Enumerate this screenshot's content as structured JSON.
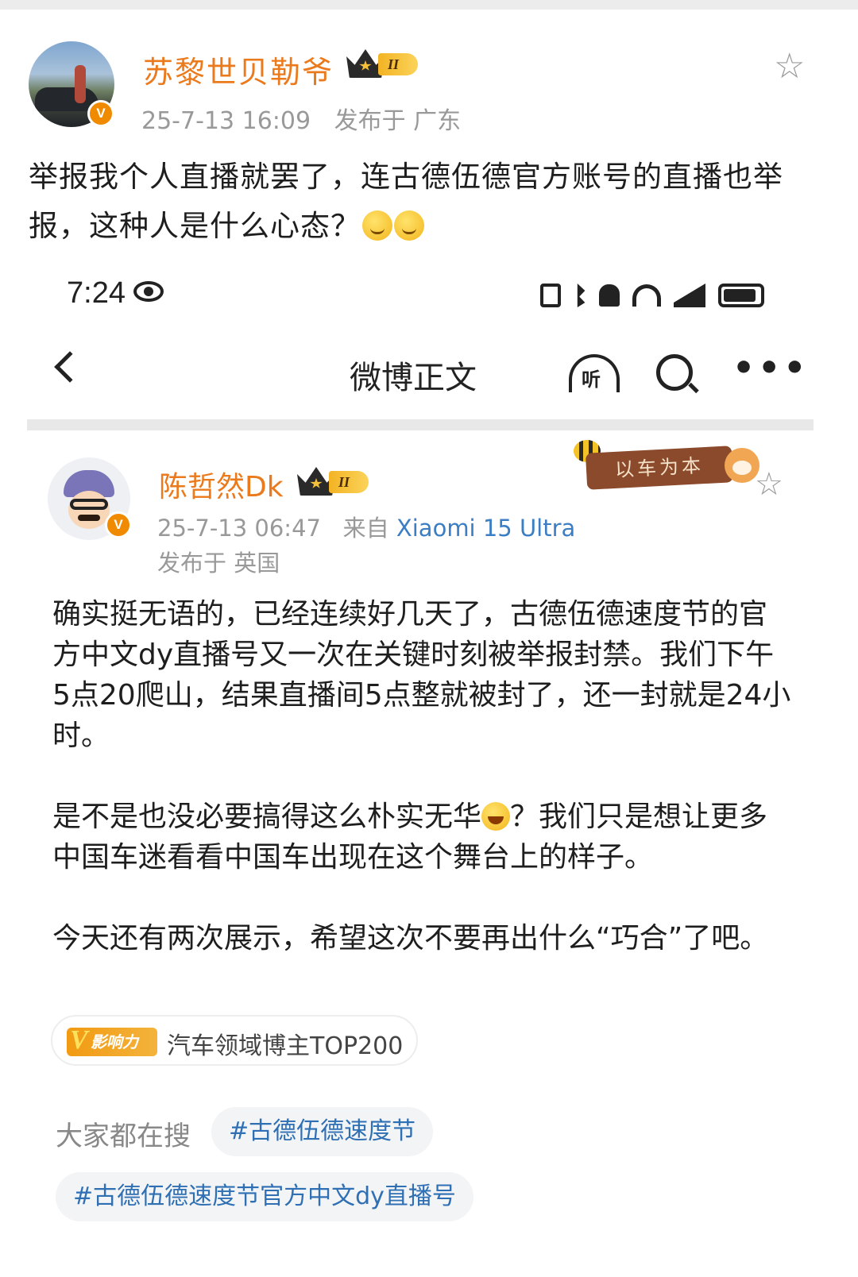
{
  "outer_post": {
    "author": "苏黎世贝勒爷",
    "member_level": "II",
    "verified": "V",
    "date": "25-7-13 16:09",
    "location": "发布于 广东",
    "text": "举报我个人直播就罢了，连古德伍德官方账号的直播也举报，这种人是什么心态？",
    "emoji": "doge-sweat-emoji",
    "favorite_icon": "star-outline-icon"
  },
  "screenshot": {
    "status_bar": {
      "time": "7:24",
      "icons": [
        "eye-icon",
        "nfc-icon",
        "bluetooth-icon",
        "mute-bell-icon",
        "wifi-icon",
        "4g-signal-icon",
        "battery-icon"
      ]
    },
    "nav": {
      "title": "微博正文",
      "listen_label": "听",
      "icons": [
        "back-icon",
        "listen-icon",
        "search-icon",
        "more-icon"
      ],
      "more_label": "•••"
    },
    "post": {
      "author": "陈哲然Dk",
      "member_level": "II",
      "verified": "V",
      "sign": "以车为本",
      "date": "25-7-13 06:47",
      "source_prefix": "来自",
      "device": "Xiaomi 15 Ultra",
      "location": "发布于 英国",
      "paragraphs": [
        "确实挺无语的，已经连续好几天了，古德伍德速度节的官方中文dy直播号又一次在关键时刻被举报封禁。我们下午5点20爬山，结果直播间5点整就被封了，还一封就是24小时。",
        "是不是也没必要搞得这么朴实无华",
        "？我们只是想让更多中国车迷看看中国车出现在这个舞台上的样子。",
        "今天还有两次展示，希望这次不要再出什么“巧合”了吧。"
      ],
      "influence_badge": "影响力",
      "influence_mark": "V",
      "influence_text": "汽车领域博主TOP200",
      "search_label": "大家都在搜",
      "hashtags": [
        "#古德伍德速度节",
        "#古德伍德速度节官方中文dy直播号"
      ]
    }
  },
  "colors": {
    "username": "#eb7a1c",
    "meta": "#999999",
    "device_link": "#3b7ec4",
    "hashtag": "#2f6fb4",
    "badge_orange": "#f08a00"
  }
}
